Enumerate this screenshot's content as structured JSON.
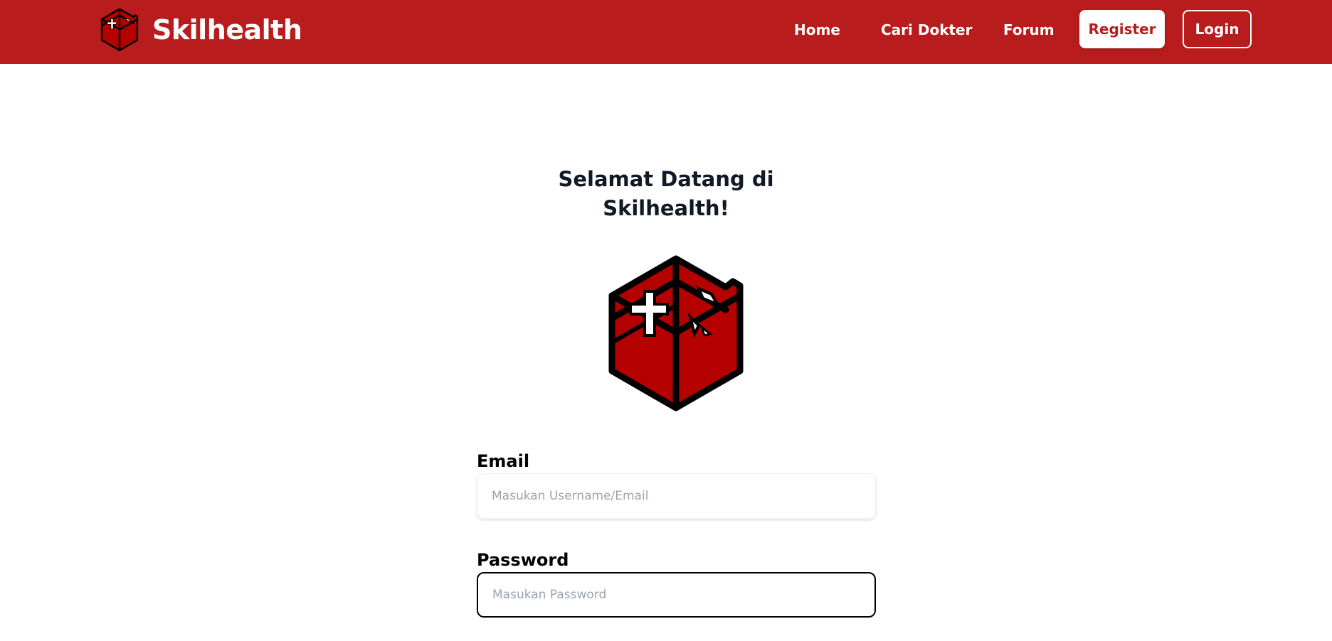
{
  "app": {
    "brand_name": "Skilhealth"
  },
  "colors": {
    "primary": "#b91c1c",
    "logo_red": "#b50000",
    "text_dark": "#111827"
  },
  "nav": {
    "links": [
      "Home",
      "Cari Dokter",
      "Forum"
    ],
    "register_label": "Register",
    "login_label": "Login"
  },
  "main": {
    "welcome_line1": "Selamat Datang di",
    "welcome_line2": "Skilhealth!"
  },
  "form": {
    "email_label": "Email",
    "email_placeholder": "Masukan Username/Email",
    "email_value": "",
    "password_label": "Password",
    "password_placeholder": "Masukan Password",
    "password_value": ""
  },
  "icons": {
    "brand_logo": "skilhealth-hexagon-logo",
    "hero_logo": "skilhealth-hexagon-logo"
  }
}
